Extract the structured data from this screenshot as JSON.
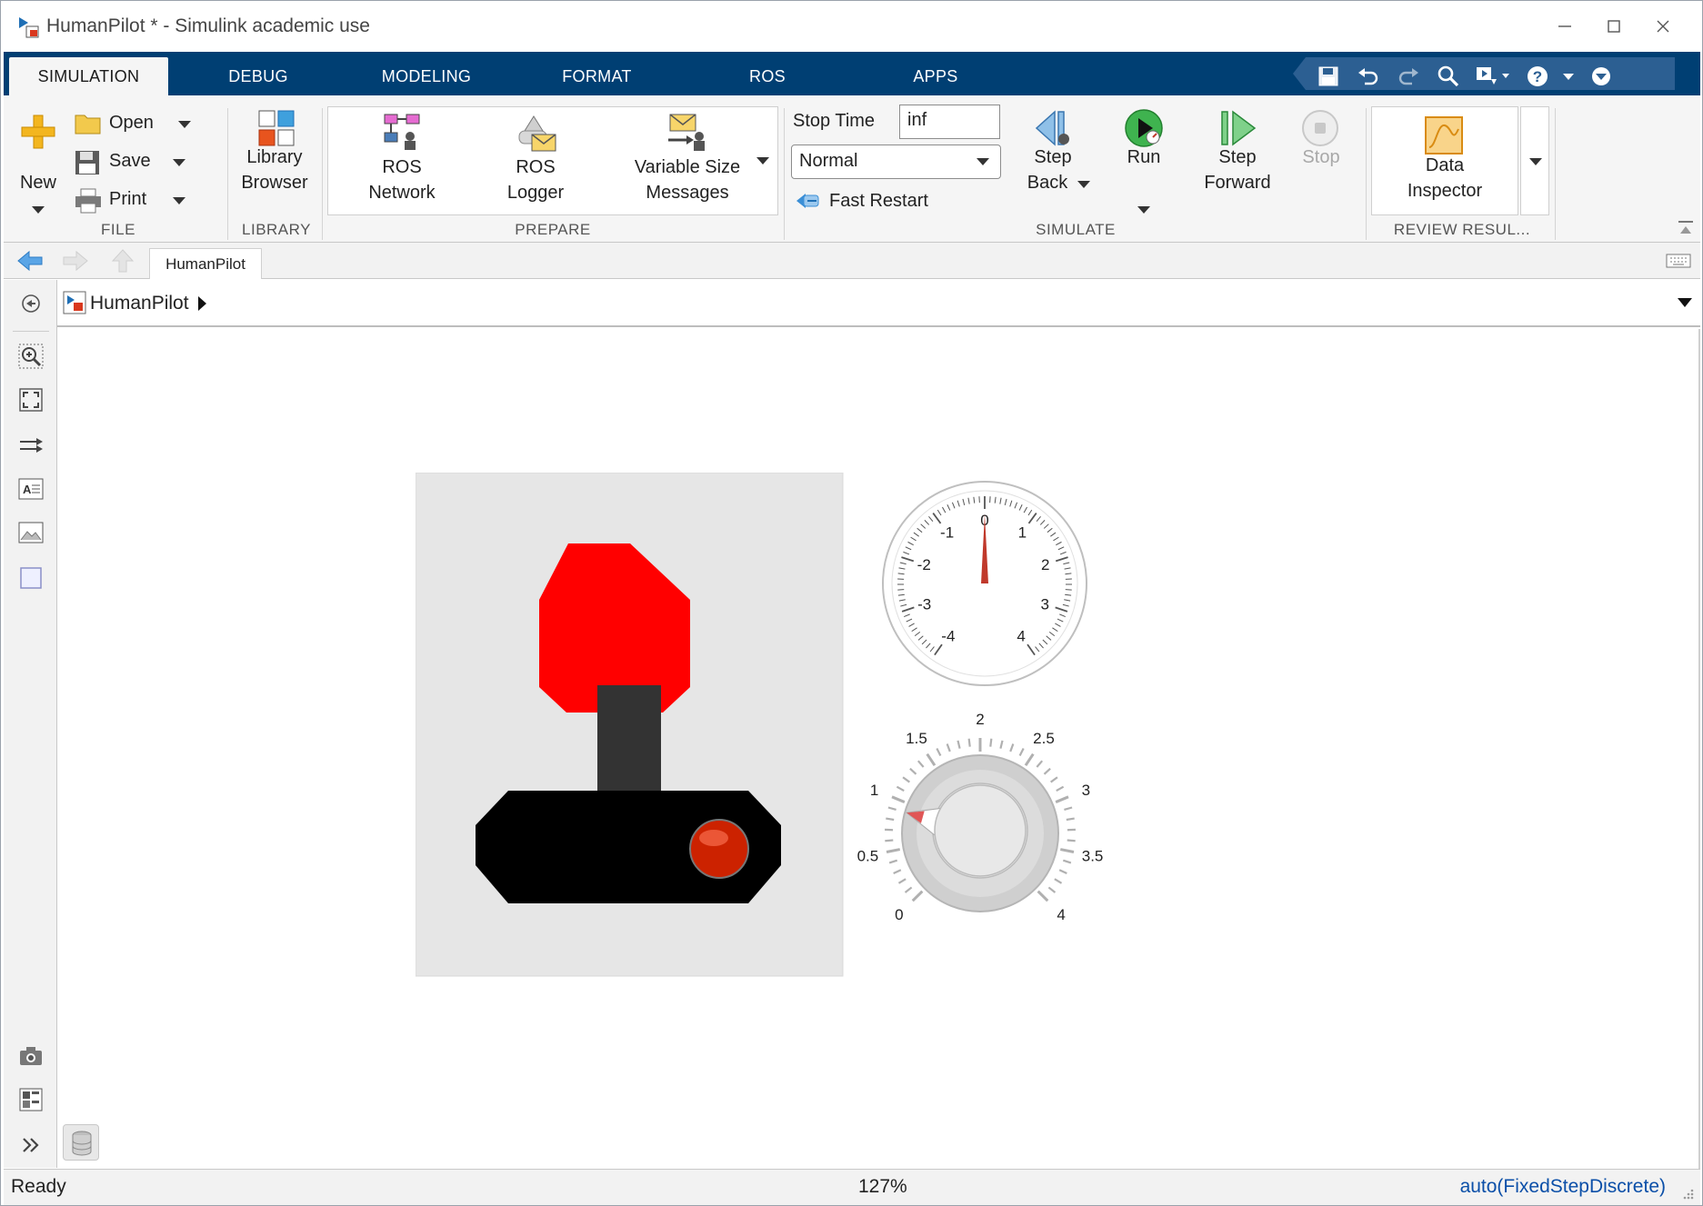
{
  "window": {
    "title": "HumanPilot * - Simulink academic use",
    "controls": [
      "minimize",
      "maximize",
      "close"
    ]
  },
  "tabs": [
    {
      "label": "SIMULATION",
      "active": true
    },
    {
      "label": "DEBUG",
      "active": false
    },
    {
      "label": "MODELING",
      "active": false
    },
    {
      "label": "FORMAT",
      "active": false
    },
    {
      "label": "ROS",
      "active": false
    },
    {
      "label": "APPS",
      "active": false
    }
  ],
  "quick_access": [
    "save-icon",
    "undo-icon",
    "redo-icon",
    "search-icon",
    "open-quickaccess-icon",
    "help-icon",
    "expand-icon"
  ],
  "ribbon": {
    "file": {
      "section": "FILE",
      "new": "New",
      "open": "Open",
      "save": "Save",
      "print": "Print"
    },
    "library": {
      "section": "LIBRARY",
      "browser_line1": "Library",
      "browser_line2": "Browser"
    },
    "prepare": {
      "section": "PREPARE",
      "items": [
        {
          "line1": "ROS",
          "line2": "Network",
          "icon": "ros-network-icon"
        },
        {
          "line1": "ROS",
          "line2": "Logger",
          "icon": "ros-logger-icon"
        },
        {
          "line1": "Variable Size",
          "line2": "Messages",
          "icon": "variable-size-messages-icon"
        }
      ]
    },
    "simulate": {
      "section": "SIMULATE",
      "stop_time_label": "Stop Time",
      "stop_time_value": "inf",
      "mode_value": "Normal",
      "fast_restart": "Fast Restart",
      "step_back_line1": "Step",
      "step_back_line2": "Back",
      "run": "Run",
      "step_forward_line1": "Step",
      "step_forward_line2": "Forward",
      "stop": "Stop"
    },
    "review": {
      "section": "REVIEW RESUL...",
      "data_inspector_line1": "Data",
      "data_inspector_line2": "Inspector"
    }
  },
  "nav": {
    "tab": "HumanPilot"
  },
  "address": {
    "model": "HumanPilot"
  },
  "gauge": {
    "ticks": [
      "-4",
      "-3",
      "-2",
      "-1",
      "0",
      "1",
      "2",
      "3",
      "4"
    ],
    "min": -4,
    "max": 4,
    "value": 0
  },
  "knob": {
    "ticks": [
      "0",
      "0.5",
      "1",
      "1.5",
      "2",
      "2.5",
      "3",
      "3.5",
      "4"
    ],
    "min": 0,
    "max": 4,
    "value": 0.9
  },
  "colors": {
    "tabstrip": "#003f73",
    "joystick_top": "#ff0000",
    "joystick_stick": "#333333",
    "joystick_base": "#000000",
    "joystick_button": "#cc2200",
    "gauge_needle": "#c0392b",
    "status_link": "#0b4fa8"
  },
  "status": {
    "left": "Ready",
    "zoom": "127%",
    "solver": "auto(FixedStepDiscrete)"
  }
}
